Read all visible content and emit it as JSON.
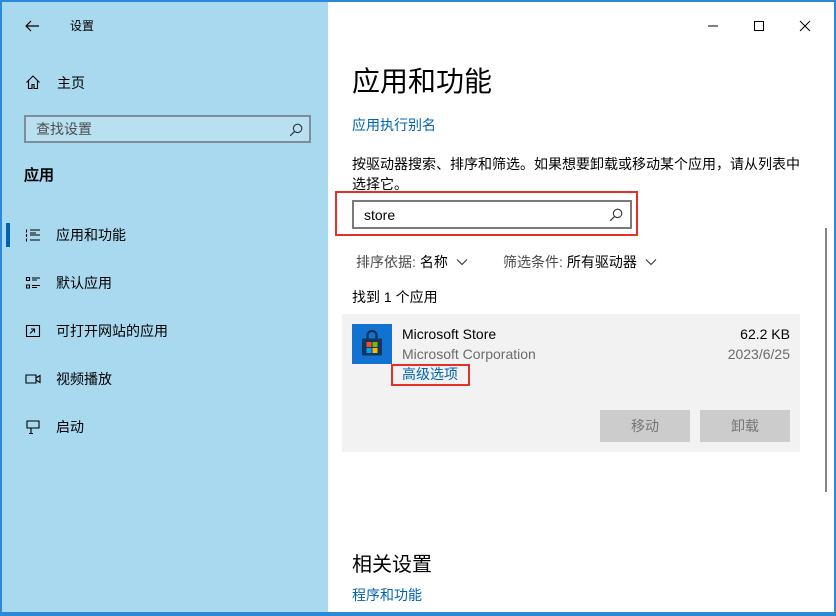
{
  "window": {
    "title": "设置",
    "back_icon": "back-arrow-icon",
    "controls": {
      "minimize": "minimize-icon",
      "maximize": "maximize-icon",
      "close": "close-icon"
    }
  },
  "sidebar": {
    "home_label": "主页",
    "home_icon": "home-icon",
    "search_placeholder": "查找设置",
    "search_icon": "search-icon",
    "section_title": "应用",
    "items": [
      {
        "label": "应用和功能",
        "icon": "apps-list-icon",
        "selected": true
      },
      {
        "label": "默认应用",
        "icon": "default-apps-icon",
        "selected": false
      },
      {
        "label": "可打开网站的应用",
        "icon": "apps-for-websites-icon",
        "selected": false
      },
      {
        "label": "视频播放",
        "icon": "video-playback-icon",
        "selected": false
      },
      {
        "label": "启动",
        "icon": "startup-icon",
        "selected": false
      }
    ]
  },
  "main": {
    "title": "应用和功能",
    "alias_link": "应用执行别名",
    "description": "按驱动器搜索、排序和筛选。如果想要卸载或移动某个应用，请从列表中选择它。",
    "search": {
      "value": "store",
      "icon": "search-icon"
    },
    "sort": {
      "label": "排序依据:",
      "value": "名称"
    },
    "filter": {
      "label": "筛选条件:",
      "value": "所有驱动器"
    },
    "result_count": "找到 1 个应用",
    "apps": [
      {
        "name": "Microsoft Store",
        "publisher": "Microsoft Corporation",
        "size": "62.2 KB",
        "date": "2023/6/25",
        "icon": "microsoft-store-icon",
        "advanced_link": "高级选项",
        "move_label": "移动",
        "uninstall_label": "卸载"
      }
    ],
    "related_title": "相关设置",
    "related_link": "程序和功能"
  },
  "colors": {
    "accent": "#0063b1",
    "sidebar": "#a9d9ee",
    "frame": "#2a8ad7",
    "highlight": "#e5302a",
    "card": "#f2f2f2",
    "button_disabled": "#cccccc"
  }
}
